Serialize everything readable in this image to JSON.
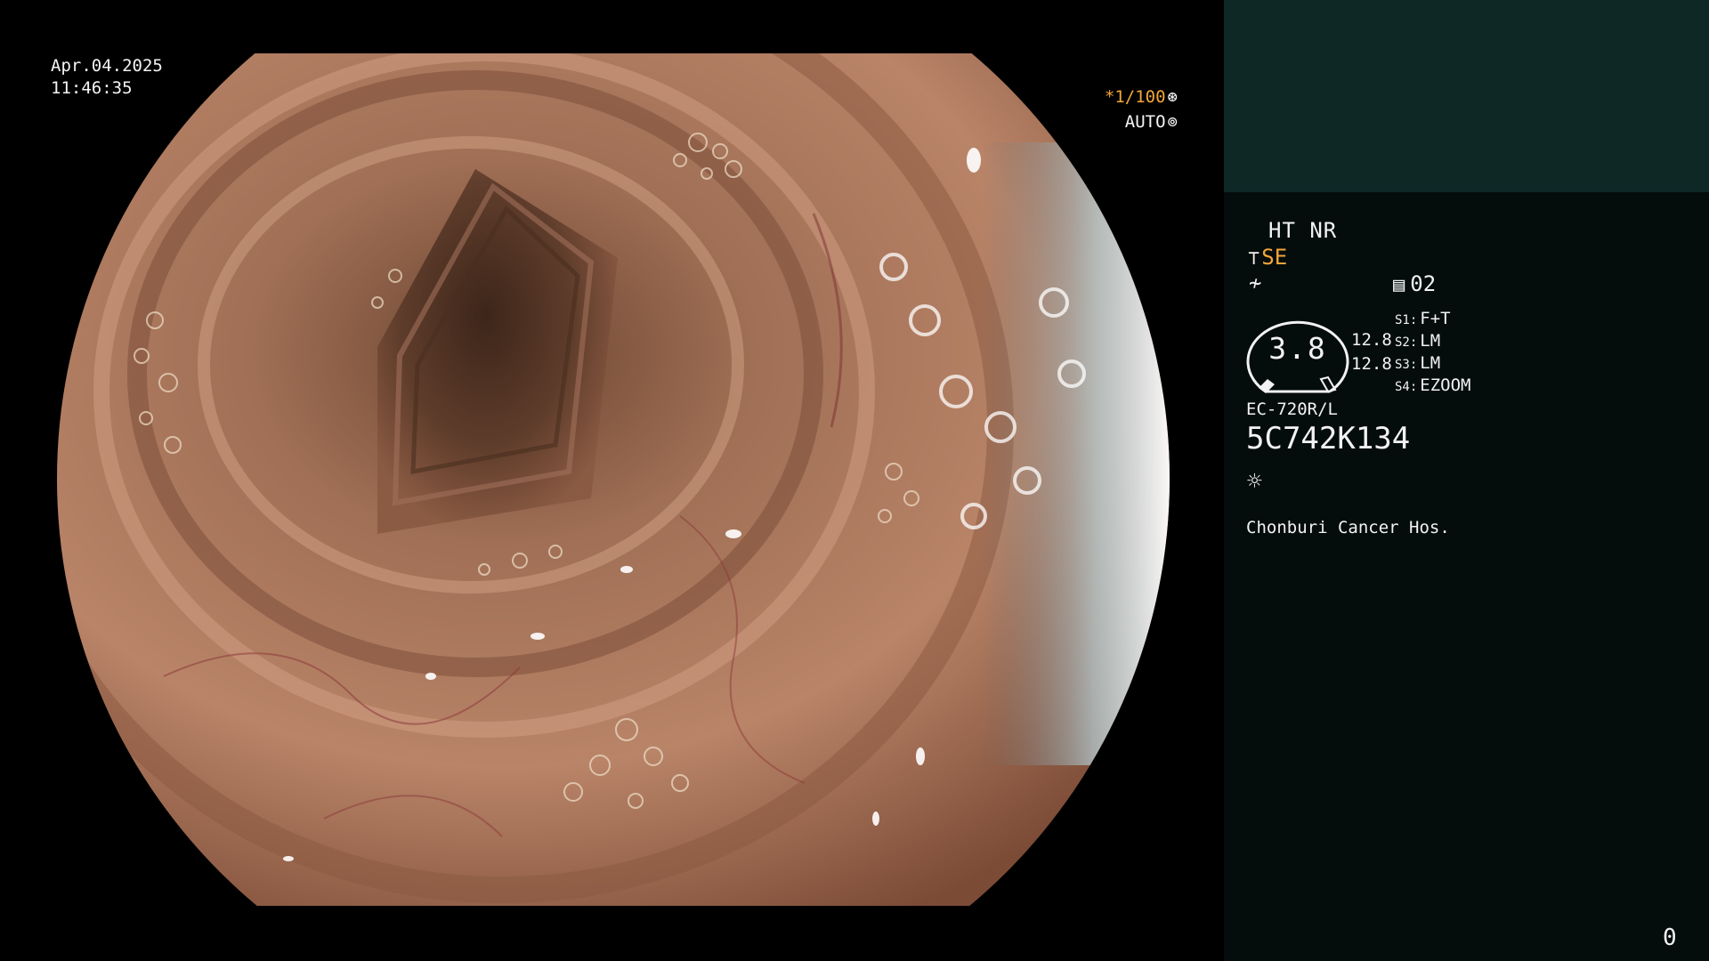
{
  "video": {
    "date": "Apr.04.2025",
    "time": "11:46:35",
    "shutter": "*1/100",
    "shutter_icon": "shutter-icon",
    "iris": "AUTO",
    "iris_icon": "iris-icon",
    "image_description": "Endoscopic view of colon lumen with mucosal folds and bubbles"
  },
  "panel": {
    "ht_nr": "HT NR",
    "structure_enhancement": "SE",
    "memory_slot": "02",
    "zoom_value": "3.8",
    "range_top": "12.8",
    "range_bottom": "12.8",
    "switches": [
      {
        "key": "S1:",
        "value": "F+T"
      },
      {
        "key": "S2:",
        "value": "LM"
      },
      {
        "key": "S3:",
        "value": "LM"
      },
      {
        "key": "S4:",
        "value": "EZOOM"
      }
    ],
    "scope_model": "EC-720R/L",
    "serial": "5C742K134",
    "hospital": "Chonburi Cancer Hos.",
    "frame_counter": "0"
  },
  "colors": {
    "accent": "#f2a63a",
    "panel_header": "#0e2826",
    "panel_body": "#040d0c",
    "text": "#f2f2f2"
  }
}
